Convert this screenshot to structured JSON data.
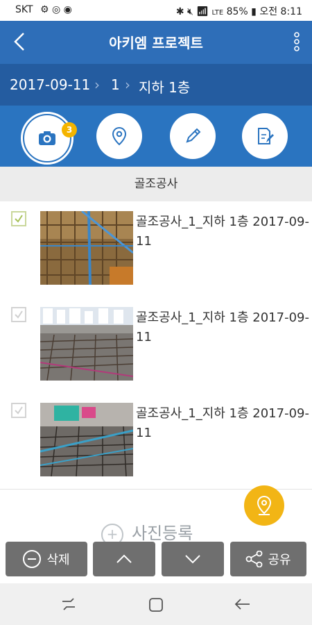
{
  "status_bar": {
    "carrier": "SKT",
    "network": "LTE",
    "battery": "85%",
    "time": "오전 8:11"
  },
  "title_bar": {
    "title": "아키엠 프로젝트",
    "back_icon": "chevron-left-icon",
    "menu_icon": "more-vert-icon"
  },
  "breadcrumb": {
    "date": "2017-09-11",
    "building": "1",
    "floor": "지하 1층"
  },
  "tools": {
    "camera_badge": "3",
    "icons": [
      "camera-icon",
      "location-pin-icon",
      "pencil-icon",
      "document-edit-icon"
    ]
  },
  "section": {
    "title": "골조공사"
  },
  "photos": [
    {
      "caption": "골조공사_1_지하 1층 2017-09-11",
      "checked": true
    },
    {
      "caption": "골조공사_1_지하 1층 2017-09-11",
      "checked": true
    },
    {
      "caption": "골조공사_1_지하 1층 2017-09-11",
      "checked": true
    }
  ],
  "add_photo": {
    "label": "사진등록"
  },
  "fab": {
    "icon": "location-pin-icon"
  },
  "toolbar": {
    "delete_label": "삭제",
    "up_icon": "chevron-up-icon",
    "down_icon": "chevron-down-icon",
    "share_label": "공유"
  },
  "colors": {
    "title_bar": "#2e6eb8",
    "breadcrumb": "#245ca0",
    "tools_bar": "#2a74c0",
    "accent": "#f4b400",
    "toolbar_button": "#6f6f6f"
  }
}
